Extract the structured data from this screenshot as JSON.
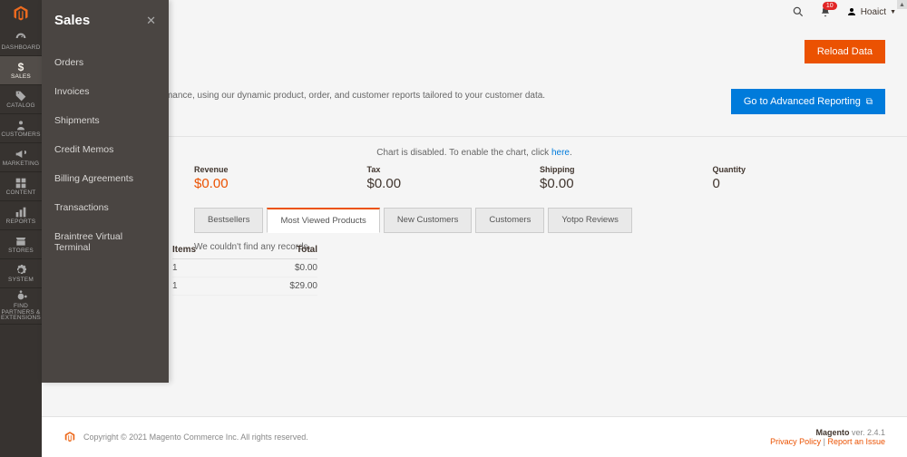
{
  "sidebar": {
    "items": [
      {
        "label": "DASHBOARD"
      },
      {
        "label": "SALES"
      },
      {
        "label": "CATALOG"
      },
      {
        "label": "CUSTOMERS"
      },
      {
        "label": "MARKETING"
      },
      {
        "label": "CONTENT"
      },
      {
        "label": "REPORTS"
      },
      {
        "label": "STORES"
      },
      {
        "label": "SYSTEM"
      },
      {
        "label": "FIND PARTNERS & EXTENSIONS"
      }
    ]
  },
  "flyout": {
    "title": "Sales",
    "items": [
      {
        "label": "Orders"
      },
      {
        "label": "Invoices"
      },
      {
        "label": "Shipments"
      },
      {
        "label": "Credit Memos"
      },
      {
        "label": "Billing Agreements"
      },
      {
        "label": "Transactions"
      },
      {
        "label": "Braintree Virtual Terminal"
      }
    ]
  },
  "topbar": {
    "notif_count": "10",
    "user": "Hoaict"
  },
  "buttons": {
    "reload": "Reload Data",
    "advanced": "Go to Advanced Reporting"
  },
  "advanced_text": "d of your business' performance, using our dynamic product, order, and customer reports tailored to your customer data.",
  "chart_msg": {
    "pre": "Chart is disabled. To enable the chart, click ",
    "link": "here",
    "post": "."
  },
  "stats": {
    "revenue": {
      "label": "Revenue",
      "value": "$0.00"
    },
    "tax": {
      "label": "Tax",
      "value": "$0.00"
    },
    "shipping": {
      "label": "Shipping",
      "value": "$0.00"
    },
    "quantity": {
      "label": "Quantity",
      "value": "0"
    }
  },
  "tabs": [
    {
      "label": "Bestsellers"
    },
    {
      "label": "Most Viewed Products"
    },
    {
      "label": "New Customers"
    },
    {
      "label": "Customers"
    },
    {
      "label": "Yotpo Reviews"
    }
  ],
  "tab_body": "We couldn't find any records.",
  "side_table": {
    "col_items": "Items",
    "col_total": "Total",
    "rows": [
      {
        "items": "1",
        "total": "$0.00"
      },
      {
        "items": "1",
        "total": "$29.00"
      }
    ]
  },
  "footer": {
    "copyright": "Copyright © 2021 Magento Commerce Inc. All rights reserved.",
    "brand": "Magento",
    "ver": " ver. 2.4.1",
    "privacy": "Privacy Policy",
    "sep": " | ",
    "report": "Report an Issue"
  }
}
